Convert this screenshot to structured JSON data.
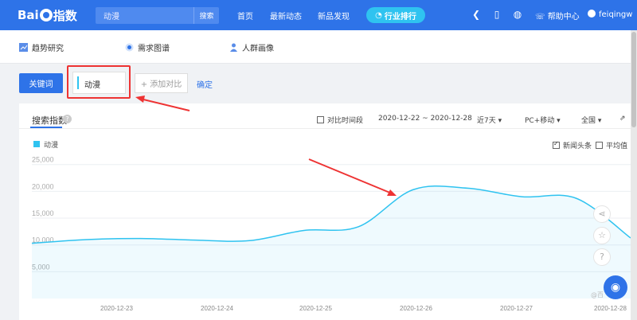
{
  "topbar": {
    "logo_text_a": "Bai",
    "logo_text_b": "指数",
    "search_value": "动漫",
    "search_button": "搜索",
    "nav": [
      "首页",
      "最新动态",
      "新品发现"
    ],
    "rank_button": "行业排行",
    "icons": [
      "download-icon",
      "phone-icon",
      "wechat-icon"
    ],
    "help": "帮助中心",
    "username": "feiqingw"
  },
  "tabs": [
    {
      "label": "趋势研究",
      "icon": "chart-icon"
    },
    {
      "label": "需求图谱",
      "icon": "target-icon"
    },
    {
      "label": "人群画像",
      "icon": "person-icon"
    }
  ],
  "keyword_bar": {
    "keyword_button": "关键词",
    "keyword": "动漫",
    "add_compare": "+ 添加对比",
    "confirm": "确定"
  },
  "card": {
    "title": "搜索指数",
    "compare_period": "对比时间段",
    "date_range": "2020-12-22 ~ 2020-12-28",
    "period": "近7天",
    "device": "PC+移动",
    "region": "全国",
    "news_label": "新闻头条",
    "news_checked": true,
    "avg_label": "平均值",
    "avg_checked": false,
    "watermark": "@百"
  },
  "colors": {
    "brand": "#2e73e8",
    "series": "#2fc3f0",
    "highlight": "#e33333"
  },
  "chart_data": {
    "type": "area",
    "series": [
      {
        "name": "动漫",
        "x": [
          "2020-12-22 12:00",
          "2020-12-23",
          "2020-12-23 12:00",
          "2020-12-24",
          "2020-12-24 12:00",
          "2020-12-25",
          "2020-12-25 12:00",
          "2020-12-26",
          "2020-12-26 12:00",
          "2020-12-27",
          "2020-12-27 12:00",
          "2020-12-28"
        ],
        "values": [
          10300,
          11000,
          11200,
          10900,
          10800,
          12700,
          13400,
          20300,
          20600,
          19000,
          18700,
          11300
        ]
      }
    ],
    "x_tick_labels": [
      "2020-12-23",
      "2020-12-24",
      "2020-12-25",
      "2020-12-26",
      "2020-12-27",
      "2020-12-28"
    ],
    "y_tick_labels": [
      "5,000",
      "10,000",
      "15,000",
      "20,000",
      "25,000"
    ],
    "ylim": [
      0,
      26000
    ],
    "grid": true,
    "legend": "top-left"
  }
}
